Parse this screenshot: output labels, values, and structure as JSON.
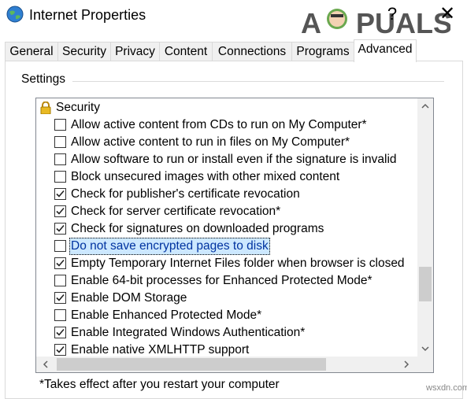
{
  "window": {
    "title": "Internet Properties",
    "help_glyph": "?",
    "close_glyph": "✕"
  },
  "watermark": {
    "text": "APPUALS"
  },
  "tabs": [
    {
      "label": "General",
      "active": false
    },
    {
      "label": "Security",
      "active": false
    },
    {
      "label": "Privacy",
      "active": false
    },
    {
      "label": "Content",
      "active": false
    },
    {
      "label": "Connections",
      "active": false
    },
    {
      "label": "Programs",
      "active": false
    },
    {
      "label": "Advanced",
      "active": true
    }
  ],
  "settings": {
    "group_label": "Settings",
    "section_header": "Security",
    "items": [
      {
        "label": "Allow active content from CDs to run on My Computer*",
        "checked": false
      },
      {
        "label": "Allow active content to run in files on My Computer*",
        "checked": false
      },
      {
        "label": "Allow software to run or install even if the signature is invalid",
        "checked": false
      },
      {
        "label": "Block unsecured images with other mixed content",
        "checked": false
      },
      {
        "label": "Check for publisher's certificate revocation",
        "checked": true
      },
      {
        "label": "Check for server certificate revocation*",
        "checked": true
      },
      {
        "label": "Check for signatures on downloaded programs",
        "checked": true
      },
      {
        "label": "Do not save encrypted pages to disk",
        "checked": false,
        "selected": true
      },
      {
        "label": "Empty Temporary Internet Files folder when browser is closed",
        "checked": true
      },
      {
        "label": "Enable 64-bit processes for Enhanced Protected Mode*",
        "checked": false
      },
      {
        "label": "Enable DOM Storage",
        "checked": true
      },
      {
        "label": "Enable Enhanced Protected Mode*",
        "checked": false
      },
      {
        "label": "Enable Integrated Windows Authentication*",
        "checked": true
      },
      {
        "label": "Enable native XMLHTTP support",
        "checked": true
      }
    ]
  },
  "footnote": "*Takes effect after you restart your computer",
  "site_mark": "wsxdn.com",
  "colors": {
    "selection_bg": "#cce8ff",
    "selection_text": "#0033a0",
    "scrollbar_track": "#f0f0f0",
    "scrollbar_thumb": "#cdcdcd"
  }
}
